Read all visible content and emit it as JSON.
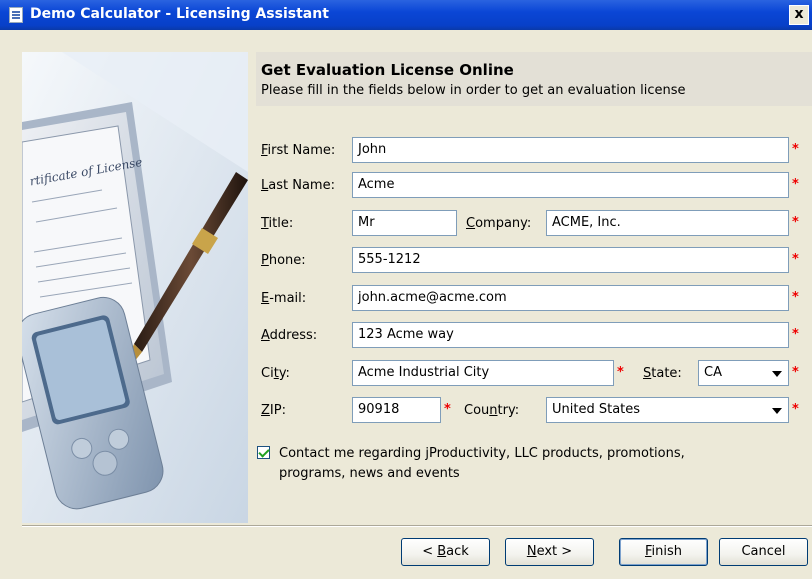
{
  "window": {
    "title": "Demo Calculator - Licensing Assistant",
    "close_glyph": "x"
  },
  "header": {
    "title": "Get Evaluation License Online",
    "subtitle": "Please fill in the fields below in order to get an evaluation license"
  },
  "form": {
    "first_name": {
      "label_ul": "F",
      "label_rest": "irst Name:",
      "value": "John"
    },
    "last_name": {
      "label_ul": "L",
      "label_rest": "ast Name:",
      "value": "Acme"
    },
    "title": {
      "label_ul": "T",
      "label_rest": "itle:",
      "value": "Mr"
    },
    "company": {
      "label_ul": "C",
      "label_rest": "ompany:",
      "value": "ACME, Inc."
    },
    "phone": {
      "label_ul": "P",
      "label_rest": "hone:",
      "value": "555-1212"
    },
    "email": {
      "label_ul": "E",
      "label_rest": "-mail:",
      "value": "john.acme@acme.com"
    },
    "address": {
      "label_ul": "A",
      "label_rest": "ddress:",
      "value": "123 Acme way"
    },
    "city": {
      "label_pre": "Ci",
      "label_ul": "t",
      "label_rest": "y:",
      "value": "Acme Industrial City"
    },
    "state": {
      "label_ul": "S",
      "label_rest": "tate:",
      "value": "CA"
    },
    "zip": {
      "label_ul": "Z",
      "label_rest": "IP:",
      "value": "90918"
    },
    "country": {
      "label_pre": "Cou",
      "label_ul": "n",
      "label_rest": "try:",
      "value": "United States"
    },
    "required_marker": "*",
    "contact_checkbox": {
      "checked": true,
      "line1": "Contact me regarding jProductivity, LLC products, promotions,",
      "line2": "programs, news and events"
    }
  },
  "buttons": {
    "back": {
      "pre": "< ",
      "ul": "B",
      "rest": "ack"
    },
    "next": {
      "ul": "N",
      "rest": "ext >"
    },
    "finish": {
      "ul": "F",
      "rest": "inish"
    },
    "cancel": "Cancel"
  },
  "colors": {
    "title_bar": "#0a46d6",
    "dialog_bg": "#ece9d8",
    "required": "#e00000",
    "field_border": "#7f9db9"
  },
  "icons": {
    "app": "app-icon",
    "close": "close-icon",
    "dropdown": "chevron-down-icon",
    "check": "checkmark-icon"
  }
}
